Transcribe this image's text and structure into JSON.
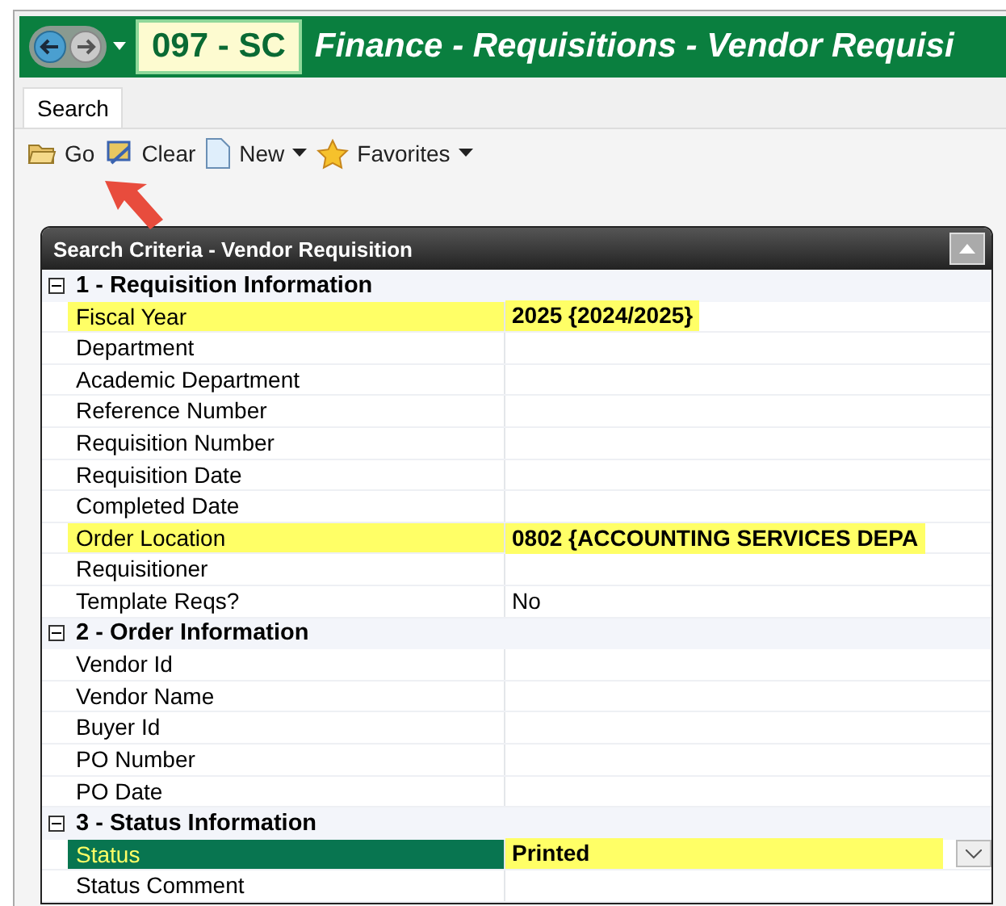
{
  "window": {
    "code": "097 - SC",
    "title": "Finance - Requisitions - Vendor Requisi"
  },
  "tabs": [
    {
      "label": "Search",
      "selected": true
    }
  ],
  "toolbar": [
    {
      "label": "Go",
      "kind": "folder",
      "dropdown": false
    },
    {
      "label": "Clear",
      "kind": "clear",
      "dropdown": false
    },
    {
      "label": "New",
      "kind": "page",
      "dropdown": true
    },
    {
      "label": "Favorites",
      "kind": "star",
      "dropdown": true
    }
  ],
  "panel": {
    "title": "Search Criteria - Vendor Requisition",
    "sections": [
      {
        "title": "1 - Requisition Information",
        "expanded": true,
        "rows": [
          {
            "label": "Fiscal Year",
            "value": "2025 {2024/2025}",
            "highlighted": true,
            "selected": false
          },
          {
            "label": "Department",
            "highlighted": false,
            "selected": false
          },
          {
            "label": "Academic Department",
            "highlighted": false,
            "selected": false
          },
          {
            "label": "Reference Number",
            "highlighted": false,
            "selected": false
          },
          {
            "label": "Requisition Number",
            "highlighted": false,
            "selected": false
          },
          {
            "label": "Requisition Date",
            "highlighted": false,
            "selected": false
          },
          {
            "label": "Completed Date",
            "highlighted": false,
            "selected": false
          },
          {
            "label": "Order Location",
            "value": "0802 {ACCOUNTING SERVICES DEPA",
            "highlighted": true,
            "selected": false
          },
          {
            "label": "Requisitioner",
            "highlighted": false,
            "selected": false
          },
          {
            "label": "Template Reqs?",
            "value": "No",
            "highlighted": false,
            "selected": false
          }
        ]
      },
      {
        "title": "2 - Order Information",
        "expanded": true,
        "rows": [
          {
            "label": "Vendor Id",
            "highlighted": false,
            "selected": false
          },
          {
            "label": "Vendor Name",
            "highlighted": false,
            "selected": false
          },
          {
            "label": "Buyer Id",
            "highlighted": false,
            "selected": false
          },
          {
            "label": "PO Number",
            "highlighted": false,
            "selected": false
          },
          {
            "label": "PO Date",
            "highlighted": false,
            "selected": false
          }
        ]
      },
      {
        "title": "3 - Status Information",
        "expanded": true,
        "rows": [
          {
            "label": "Status",
            "value": "Printed",
            "highlighted": true,
            "selected": true,
            "kind": "dropdown"
          },
          {
            "label": "Status Comment",
            "highlighted": false,
            "selected": false
          }
        ]
      }
    ]
  }
}
